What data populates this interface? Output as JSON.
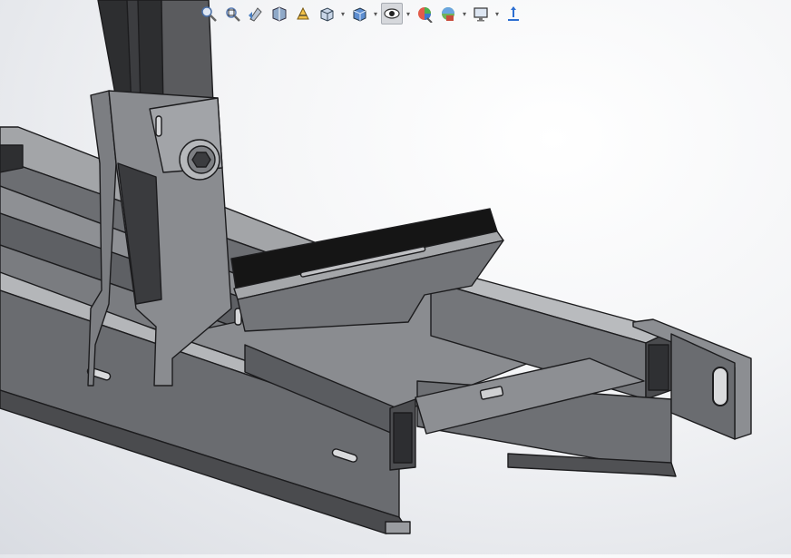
{
  "window": {
    "background_top": "#ffffff",
    "background_bottom": "#d9dce2"
  },
  "toolbar": {
    "items": [
      {
        "name": "zoom-to-fit-icon",
        "dropdown": false
      },
      {
        "name": "zoom-to-area-icon",
        "dropdown": false
      },
      {
        "name": "previous-view-icon",
        "dropdown": false
      },
      {
        "name": "section-view-icon",
        "dropdown": false
      },
      {
        "name": "dynamic-annotation-icon",
        "dropdown": false
      },
      {
        "name": "view-orientation-icon",
        "dropdown": true
      },
      {
        "name": "display-style-icon",
        "dropdown": true
      },
      {
        "name": "hide-show-items-icon",
        "dropdown": true,
        "active": true
      },
      {
        "name": "edit-appearance-icon",
        "dropdown": false
      },
      {
        "name": "apply-scene-icon",
        "dropdown": true
      },
      {
        "name": "view-settings-icon",
        "dropdown": true
      },
      {
        "name": "triad-icon",
        "dropdown": false
      }
    ]
  },
  "model": {
    "steel_dark": "#3e3f42",
    "steel_mid": "#707276",
    "steel_light": "#a3a5a8",
    "steel_highlight": "#c4c6c9",
    "edge": "#1c1c1e",
    "rubber": "#151515"
  }
}
